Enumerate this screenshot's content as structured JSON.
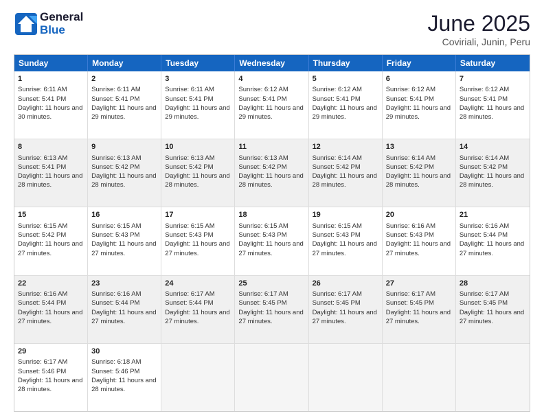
{
  "logo": {
    "general": "General",
    "blue": "Blue"
  },
  "title": "June 2025",
  "location": "Coviriali, Junin, Peru",
  "days": [
    "Sunday",
    "Monday",
    "Tuesday",
    "Wednesday",
    "Thursday",
    "Friday",
    "Saturday"
  ],
  "weeks": [
    [
      {
        "num": "1",
        "sunrise": "Sunrise: 6:11 AM",
        "sunset": "Sunset: 5:41 PM",
        "daylight": "Daylight: 11 hours and 30 minutes."
      },
      {
        "num": "2",
        "sunrise": "Sunrise: 6:11 AM",
        "sunset": "Sunset: 5:41 PM",
        "daylight": "Daylight: 11 hours and 29 minutes."
      },
      {
        "num": "3",
        "sunrise": "Sunrise: 6:11 AM",
        "sunset": "Sunset: 5:41 PM",
        "daylight": "Daylight: 11 hours and 29 minutes."
      },
      {
        "num": "4",
        "sunrise": "Sunrise: 6:12 AM",
        "sunset": "Sunset: 5:41 PM",
        "daylight": "Daylight: 11 hours and 29 minutes."
      },
      {
        "num": "5",
        "sunrise": "Sunrise: 6:12 AM",
        "sunset": "Sunset: 5:41 PM",
        "daylight": "Daylight: 11 hours and 29 minutes."
      },
      {
        "num": "6",
        "sunrise": "Sunrise: 6:12 AM",
        "sunset": "Sunset: 5:41 PM",
        "daylight": "Daylight: 11 hours and 29 minutes."
      },
      {
        "num": "7",
        "sunrise": "Sunrise: 6:12 AM",
        "sunset": "Sunset: 5:41 PM",
        "daylight": "Daylight: 11 hours and 28 minutes."
      }
    ],
    [
      {
        "num": "8",
        "sunrise": "Sunrise: 6:13 AM",
        "sunset": "Sunset: 5:41 PM",
        "daylight": "Daylight: 11 hours and 28 minutes."
      },
      {
        "num": "9",
        "sunrise": "Sunrise: 6:13 AM",
        "sunset": "Sunset: 5:42 PM",
        "daylight": "Daylight: 11 hours and 28 minutes."
      },
      {
        "num": "10",
        "sunrise": "Sunrise: 6:13 AM",
        "sunset": "Sunset: 5:42 PM",
        "daylight": "Daylight: 11 hours and 28 minutes."
      },
      {
        "num": "11",
        "sunrise": "Sunrise: 6:13 AM",
        "sunset": "Sunset: 5:42 PM",
        "daylight": "Daylight: 11 hours and 28 minutes."
      },
      {
        "num": "12",
        "sunrise": "Sunrise: 6:14 AM",
        "sunset": "Sunset: 5:42 PM",
        "daylight": "Daylight: 11 hours and 28 minutes."
      },
      {
        "num": "13",
        "sunrise": "Sunrise: 6:14 AM",
        "sunset": "Sunset: 5:42 PM",
        "daylight": "Daylight: 11 hours and 28 minutes."
      },
      {
        "num": "14",
        "sunrise": "Sunrise: 6:14 AM",
        "sunset": "Sunset: 5:42 PM",
        "daylight": "Daylight: 11 hours and 28 minutes."
      }
    ],
    [
      {
        "num": "15",
        "sunrise": "Sunrise: 6:15 AM",
        "sunset": "Sunset: 5:42 PM",
        "daylight": "Daylight: 11 hours and 27 minutes."
      },
      {
        "num": "16",
        "sunrise": "Sunrise: 6:15 AM",
        "sunset": "Sunset: 5:43 PM",
        "daylight": "Daylight: 11 hours and 27 minutes."
      },
      {
        "num": "17",
        "sunrise": "Sunrise: 6:15 AM",
        "sunset": "Sunset: 5:43 PM",
        "daylight": "Daylight: 11 hours and 27 minutes."
      },
      {
        "num": "18",
        "sunrise": "Sunrise: 6:15 AM",
        "sunset": "Sunset: 5:43 PM",
        "daylight": "Daylight: 11 hours and 27 minutes."
      },
      {
        "num": "19",
        "sunrise": "Sunrise: 6:15 AM",
        "sunset": "Sunset: 5:43 PM",
        "daylight": "Daylight: 11 hours and 27 minutes."
      },
      {
        "num": "20",
        "sunrise": "Sunrise: 6:16 AM",
        "sunset": "Sunset: 5:43 PM",
        "daylight": "Daylight: 11 hours and 27 minutes."
      },
      {
        "num": "21",
        "sunrise": "Sunrise: 6:16 AM",
        "sunset": "Sunset: 5:44 PM",
        "daylight": "Daylight: 11 hours and 27 minutes."
      }
    ],
    [
      {
        "num": "22",
        "sunrise": "Sunrise: 6:16 AM",
        "sunset": "Sunset: 5:44 PM",
        "daylight": "Daylight: 11 hours and 27 minutes."
      },
      {
        "num": "23",
        "sunrise": "Sunrise: 6:16 AM",
        "sunset": "Sunset: 5:44 PM",
        "daylight": "Daylight: 11 hours and 27 minutes."
      },
      {
        "num": "24",
        "sunrise": "Sunrise: 6:17 AM",
        "sunset": "Sunset: 5:44 PM",
        "daylight": "Daylight: 11 hours and 27 minutes."
      },
      {
        "num": "25",
        "sunrise": "Sunrise: 6:17 AM",
        "sunset": "Sunset: 5:45 PM",
        "daylight": "Daylight: 11 hours and 27 minutes."
      },
      {
        "num": "26",
        "sunrise": "Sunrise: 6:17 AM",
        "sunset": "Sunset: 5:45 PM",
        "daylight": "Daylight: 11 hours and 27 minutes."
      },
      {
        "num": "27",
        "sunrise": "Sunrise: 6:17 AM",
        "sunset": "Sunset: 5:45 PM",
        "daylight": "Daylight: 11 hours and 27 minutes."
      },
      {
        "num": "28",
        "sunrise": "Sunrise: 6:17 AM",
        "sunset": "Sunset: 5:45 PM",
        "daylight": "Daylight: 11 hours and 27 minutes."
      }
    ],
    [
      {
        "num": "29",
        "sunrise": "Sunrise: 6:17 AM",
        "sunset": "Sunset: 5:46 PM",
        "daylight": "Daylight: 11 hours and 28 minutes."
      },
      {
        "num": "30",
        "sunrise": "Sunrise: 6:18 AM",
        "sunset": "Sunset: 5:46 PM",
        "daylight": "Daylight: 11 hours and 28 minutes."
      },
      {
        "num": "",
        "sunrise": "",
        "sunset": "",
        "daylight": ""
      },
      {
        "num": "",
        "sunrise": "",
        "sunset": "",
        "daylight": ""
      },
      {
        "num": "",
        "sunrise": "",
        "sunset": "",
        "daylight": ""
      },
      {
        "num": "",
        "sunrise": "",
        "sunset": "",
        "daylight": ""
      },
      {
        "num": "",
        "sunrise": "",
        "sunset": "",
        "daylight": ""
      }
    ]
  ]
}
